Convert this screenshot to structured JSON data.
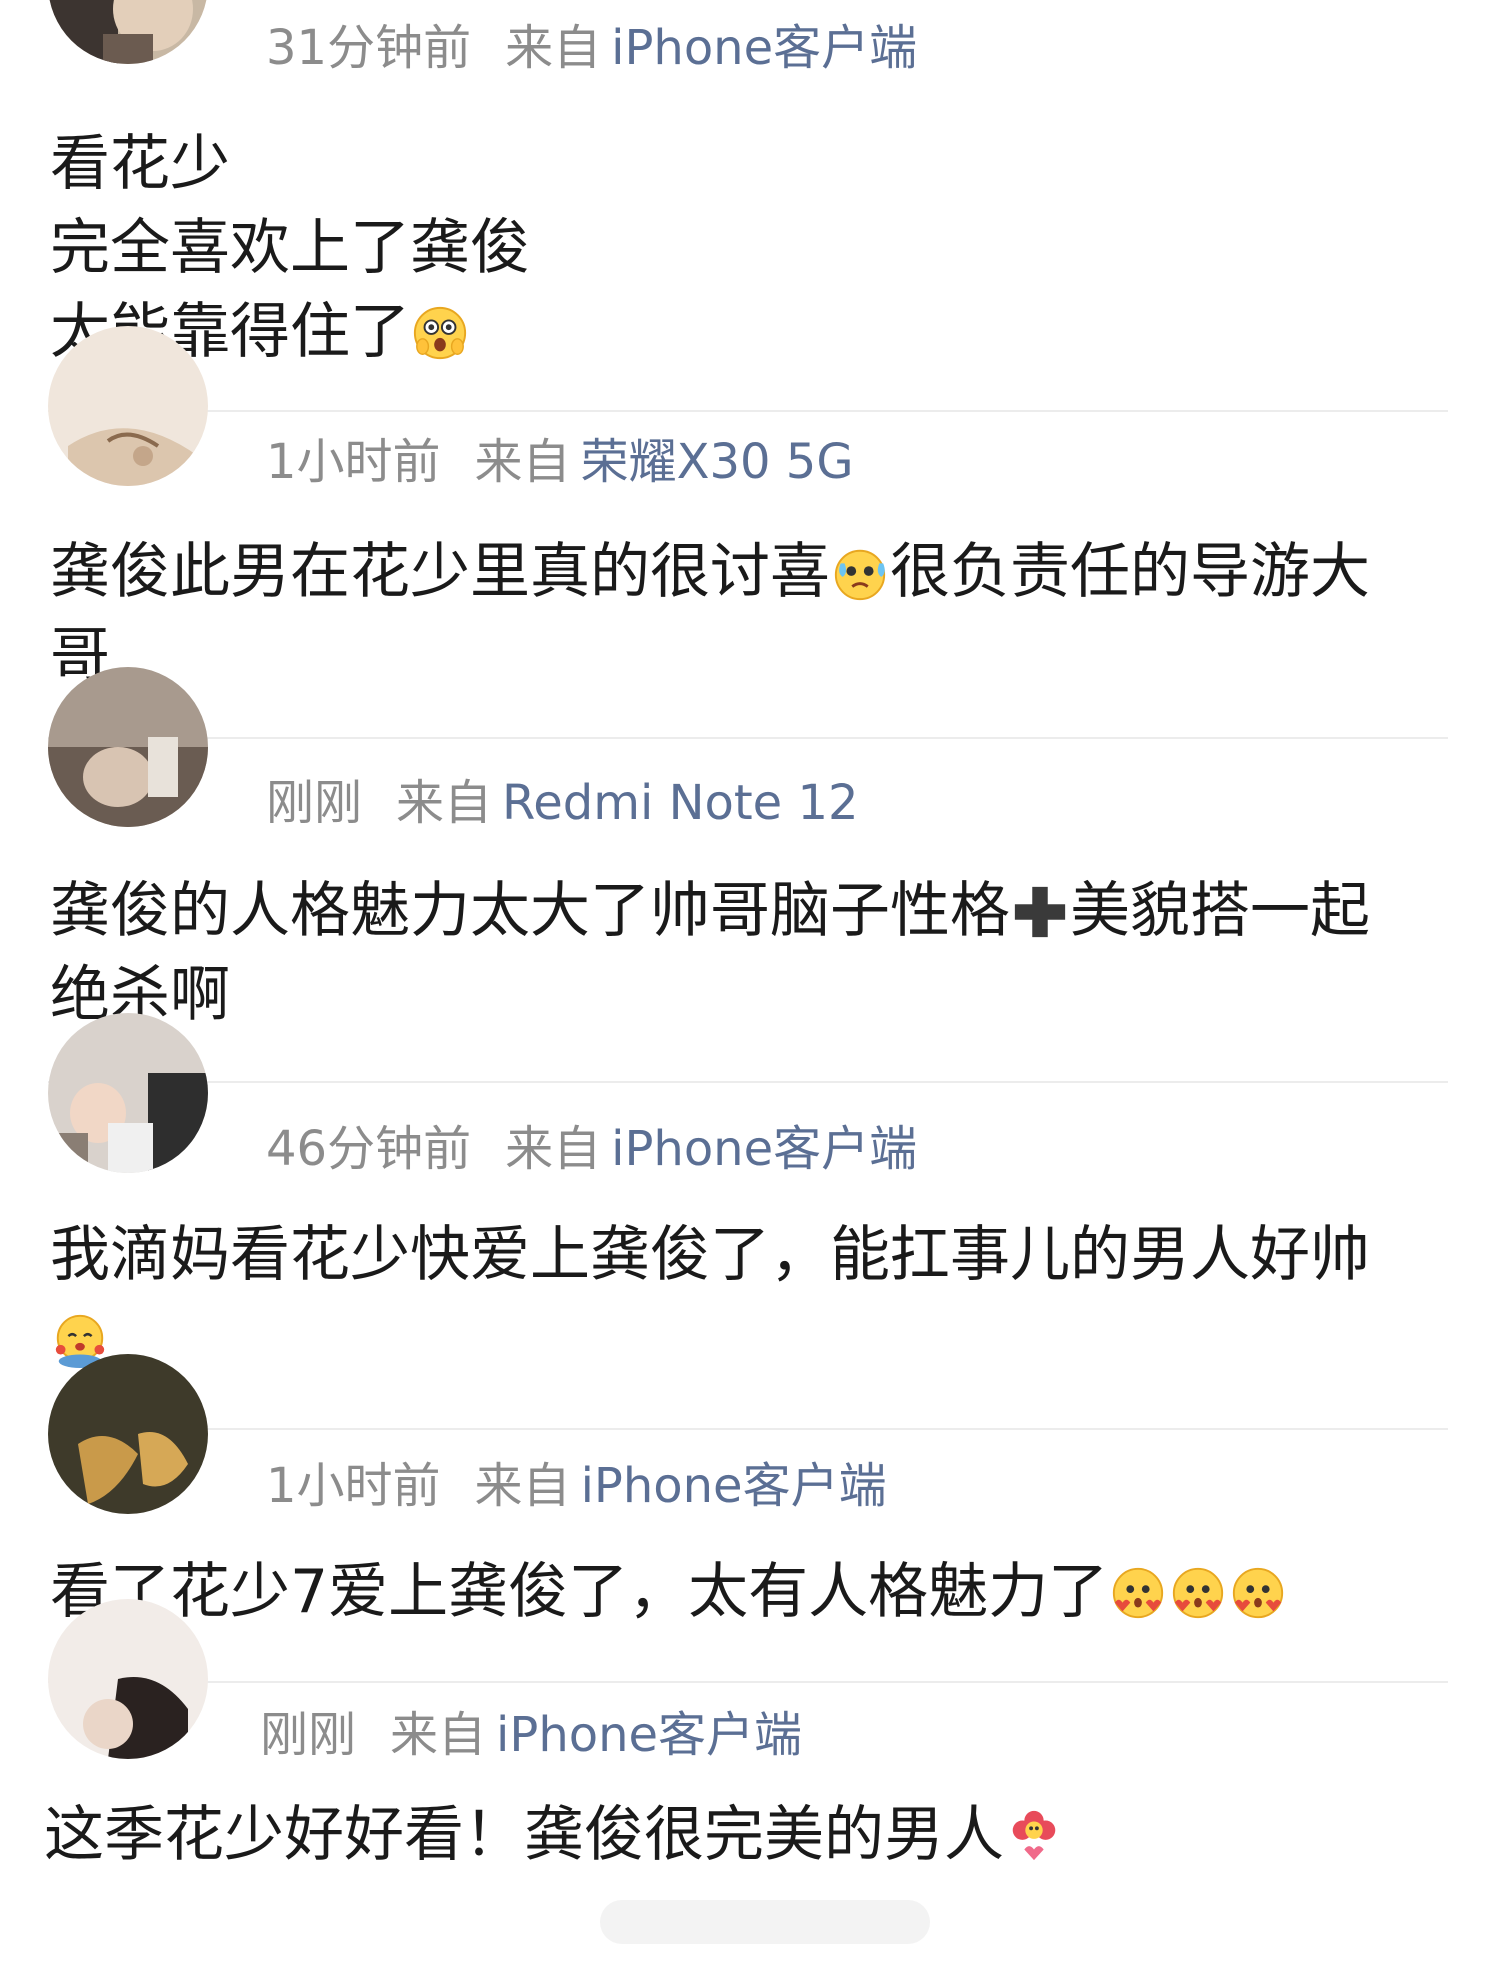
{
  "colors": {
    "meta_gray": "#8c8c8c",
    "device_blue": "#5b6f94",
    "text": "#1a1a1a",
    "divider": "#ececec"
  },
  "comments": [
    {
      "time": "31分钟前",
      "from": "来自",
      "device": "iPhone客户端",
      "lines": [
        "看花少",
        "完全喜欢上了龚俊",
        "太能靠得住了"
      ],
      "emoji": [
        "shocked-emoji"
      ]
    },
    {
      "time": "1小时前",
      "from": "来自",
      "device": "荣耀X30 5G",
      "lines": [
        "龚俊此男在花少里真的很讨喜",
        "很负责任的导游大",
        "哥"
      ],
      "emoji": [
        "crying-emoji"
      ]
    },
    {
      "time": "刚刚",
      "from": "来自",
      "device": "Redmi Note 12",
      "lines": [
        "龚俊的人格魅力太大了帅哥脑子性格",
        "美貌搭一起",
        "绝杀啊"
      ],
      "emoji": [
        "plus-emoji"
      ]
    },
    {
      "time": "46分钟前",
      "from": "来自",
      "device": "iPhone客户端",
      "lines": [
        "我滴妈看花少快爱上龚俊了，能扛事儿的男人好帅"
      ],
      "emoji": [
        "hug-emoji"
      ]
    },
    {
      "time": "1小时前",
      "from": "来自",
      "device": "iPhone客户端",
      "lines": [
        "看了花少7爱上龚俊了，太有人格魅力了"
      ],
      "emoji": [
        "heart-blush-emoji",
        "heart-blush-emoji",
        "heart-blush-emoji"
      ]
    },
    {
      "time": "刚刚",
      "from": "来自",
      "device": "iPhone客户端",
      "lines": [
        "这季花少好好看！龚俊很完美的男人"
      ],
      "emoji": [
        "love-flower-emoji"
      ]
    }
  ]
}
